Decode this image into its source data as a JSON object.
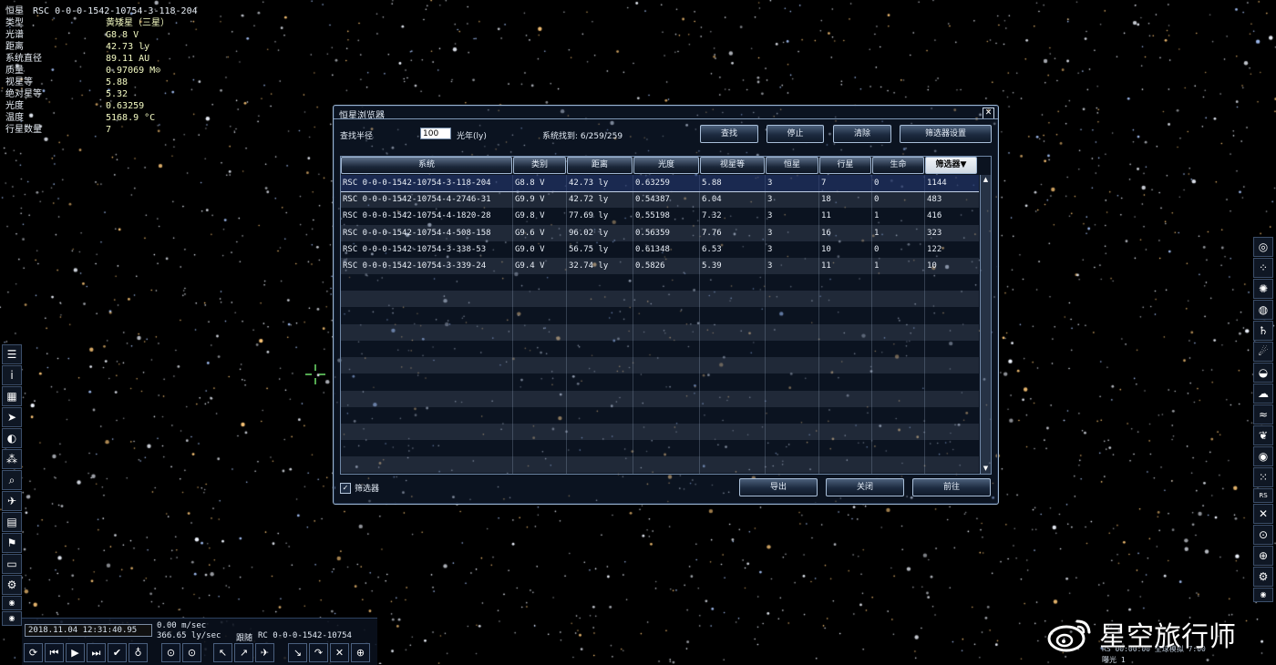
{
  "info_panel": {
    "title_label": "恒星",
    "title_value": "RSC 0-0-0-1542-10754-3-118-204",
    "rows": [
      {
        "label": "类型",
        "value": "黄矮星（三星）"
      },
      {
        "label": "光谱",
        "value": "G8.8 V"
      },
      {
        "label": "距离",
        "value": "42.73 ly"
      },
      {
        "label": "系统直径",
        "value": "89.11 AU"
      },
      {
        "label": "质量",
        "value": "0.97069 M⊙"
      },
      {
        "label": "视星等",
        "value": "5.88"
      },
      {
        "label": "绝对星等",
        "value": "5.32"
      },
      {
        "label": "光度",
        "value": "0.63259"
      },
      {
        "label": "温度",
        "value": "5168.9 °C"
      },
      {
        "label": "行星数量",
        "value": "7"
      }
    ]
  },
  "dialog": {
    "title": "恒星浏览器",
    "close_glyph": "✕",
    "radius_label": "查找半径",
    "radius_value": "100",
    "radius_unit": "光年(ly)",
    "systems_found": "系统找到:  6/259/259",
    "buttons": {
      "find": "查找",
      "stop": "停止",
      "clear": "清除",
      "filter_settings": "筛选器设置",
      "export": "导出",
      "close": "关闭",
      "goto": "前往"
    },
    "filter_checkbox_label": "筛选器",
    "filter_checked_glyph": "✓",
    "table": {
      "headers": [
        "系统",
        "类别",
        "距离",
        "光度",
        "视星等",
        "恒星",
        "行星",
        "生命",
        "筛选器▼"
      ],
      "rows": [
        [
          "RSC 0-0-0-1542-10754-3-118-204",
          "G8.8 V",
          "42.73 ly",
          "0.63259",
          "5.88",
          "3",
          "7",
          "0",
          "1144"
        ],
        [
          "RSC 0-0-0-1542-10754-4-2746-31",
          "G9.9 V",
          "42.72 ly",
          "0.54387",
          "6.04",
          "3",
          "18",
          "0",
          "483"
        ],
        [
          "RSC 0-0-0-1542-10754-4-1820-28",
          "G9.8 V",
          "77.69 ly",
          "0.55198",
          "7.32",
          "3",
          "11",
          "1",
          "416"
        ],
        [
          "RSC 0-0-0-1542-10754-4-508-158",
          "G9.6 V",
          "96.02 ly",
          "0.56359",
          "7.76",
          "3",
          "16",
          "1",
          "323"
        ],
        [
          "RSC 0-0-0-1542-10754-3-338-53",
          "G9.0 V",
          "56.75 ly",
          "0.61348",
          "6.53",
          "3",
          "10",
          "0",
          "122"
        ],
        [
          "RSC 0-0-0-1542-10754-3-339-24",
          "G9.4 V",
          "32.74 ly",
          "0.5826",
          "5.39",
          "3",
          "11",
          "1",
          "10"
        ]
      ],
      "scroll_up": "▲",
      "scroll_down": "▼"
    }
  },
  "left_toolbar": [
    {
      "name": "menu-icon",
      "glyph": "☰"
    },
    {
      "name": "info-icon",
      "glyph": "i"
    },
    {
      "name": "calendar-grid-icon",
      "glyph": "▦"
    },
    {
      "name": "comet-icon",
      "glyph": "➤"
    },
    {
      "name": "faces-icon",
      "glyph": "◐"
    },
    {
      "name": "stars-icon",
      "glyph": "⁂"
    },
    {
      "name": "search-icon",
      "glyph": "⌕"
    },
    {
      "name": "ship-icon",
      "glyph": "✈"
    },
    {
      "name": "script-icon",
      "glyph": "▤"
    },
    {
      "name": "flag-icon",
      "glyph": "⚑"
    },
    {
      "name": "monitor-icon",
      "glyph": "▭"
    },
    {
      "name": "settings-icon",
      "glyph": "⚙"
    },
    {
      "name": "record-icon",
      "glyph": "◉"
    },
    {
      "name": "camera-icon",
      "glyph": "◉"
    }
  ],
  "right_toolbar": [
    {
      "name": "galaxy-icon",
      "glyph": "◎"
    },
    {
      "name": "star-cluster-icon",
      "glyph": "⁘"
    },
    {
      "name": "nebula-icon",
      "glyph": "✺"
    },
    {
      "name": "black-hole-icon",
      "glyph": "◍"
    },
    {
      "name": "planet-rings-icon",
      "glyph": "♄"
    },
    {
      "name": "comet-tail-icon",
      "glyph": "☄"
    },
    {
      "name": "atmosphere-icon",
      "glyph": "◒"
    },
    {
      "name": "cloud-icon",
      "glyph": "☁"
    },
    {
      "name": "water-icon",
      "glyph": "≈"
    },
    {
      "name": "vegetation-icon",
      "glyph": "❦"
    },
    {
      "name": "eye-icon",
      "glyph": "◉"
    },
    {
      "name": "grid-dots-icon",
      "glyph": "⁙"
    },
    {
      "name": "rs-icon",
      "glyph": "RS"
    },
    {
      "name": "expand-icon",
      "glyph": "✕"
    },
    {
      "name": "orbit-icon",
      "glyph": "⊙"
    },
    {
      "name": "globe-icon",
      "glyph": "⊕"
    },
    {
      "name": "settings-icon",
      "glyph": "⚙"
    },
    {
      "name": "record-icon",
      "glyph": "◉"
    }
  ],
  "bottom_bar": {
    "datetime": "2018.11.04  12:31:40.95",
    "speed_1": "0.00 m/sec",
    "speed_2": "366.65 ly/sec",
    "follow_label": "跟随",
    "follow_target": "RC 0-0-0-1542-10754",
    "controls": [
      "⟳",
      "⏮",
      "▶",
      "⏭",
      "✔",
      "♁",
      "⊙",
      "⊙",
      "↖",
      "↗",
      "✈",
      "↘",
      "↷",
      "✕",
      "⊕"
    ]
  },
  "status_bottom_right": {
    "line1": "RS 00:00:00    全球模拟        7:00",
    "line2": "曝光 1"
  },
  "watermark": {
    "text": "星空旅行师"
  },
  "colors": {
    "info_value": "#f4fbc3",
    "dialog_border": "#9db6d2",
    "selected_row": "#283c78"
  }
}
